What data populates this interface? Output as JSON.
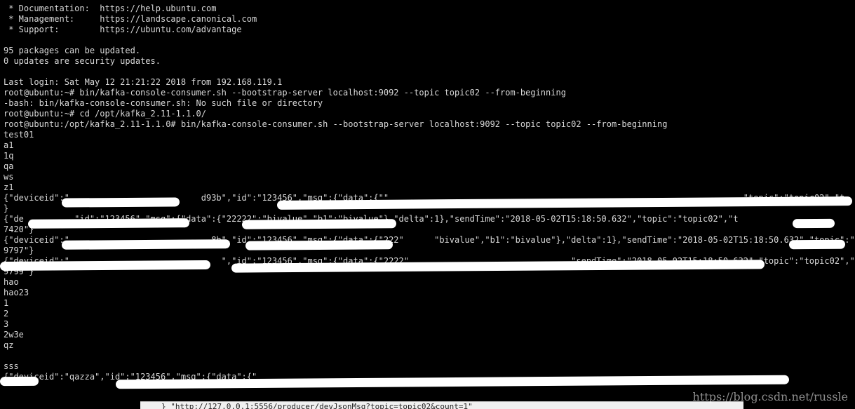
{
  "terminal": {
    "lines": [
      " * Documentation:  https://help.ubuntu.com",
      " * Management:     https://landscape.canonical.com",
      " * Support:        https://ubuntu.com/advantage",
      "",
      "95 packages can be updated.",
      "0 updates are security updates.",
      "",
      "Last login: Sat May 12 21:21:22 2018 from 192.168.119.1",
      "root@ubuntu:~# bin/kafka-console-consumer.sh --bootstrap-server localhost:9092 --topic topic02 --from-beginning",
      "-bash: bin/kafka-console-consumer.sh: No such file or directory",
      "root@ubuntu:~# cd /opt/kafka_2.11-1.1.0/",
      "root@ubuntu:/opt/kafka_2.11-1.1.0# bin/kafka-console-consumer.sh --bootstrap-server localhost:9092 --topic topic02 --from-beginning",
      "test01",
      "a1",
      "1q",
      "qa",
      "ws",
      "z1",
      "{\"deviceid\":\"                          d93b\",\"id\":\"123456\",\"msg\":{\"data\":{\"\"                                                                      \"topic\":\"topic02\",\"t",
      "}",
      "{\"de          \"id\":\"123456\",\"msg\":{\"data\":{\"22222\":\"bivalue\",\"b1\":\"bivalue\"},\"delta\":1},\"sendTime\":\"2018-05-02T15:18:50.632\",\"topic\":\"topic02\",\"t",
      "7420\"}",
      "{\"deviceid\":\"                            8b\",\"id\":\"123456\",\"msg\":{\"data\":{\"222\"      \"bivalue\",\"b1\":\"bivalue\"},\"delta\":1},\"sendTime\":\"2018-05-02T15:18:50.632\",\"topic\":\"topic02\",\"t",
      "9797\"}",
      "{\"deviceid\":\"                              \",\"id\":\"123456\",\"msg\":{\"data\":{\"2222\"                                \"sendTime\":\"2018-05-02T15:18:50.632\",\"topic\":\"topic02\",\"t",
      "9799\"}",
      "hao",
      "hao23",
      "1",
      "2",
      "3",
      "2w3e",
      "qz",
      "",
      "sss",
      "{\"deviceid\":\"qazza\",\"id\":\"123456\",\"msg\":{\"data\":{\"                                                                                                                       93\"}"
    ]
  },
  "underlay": {
    "text": "} \"http://127.0.0.1:5556/producer/devJsonMsg?topic=topic02&count=1\""
  },
  "watermark": {
    "text": "https://blog.csdn.net/russle"
  },
  "colors": {
    "background": "#000000",
    "foreground": "#d8d8d8",
    "redaction": "#ffffff"
  }
}
